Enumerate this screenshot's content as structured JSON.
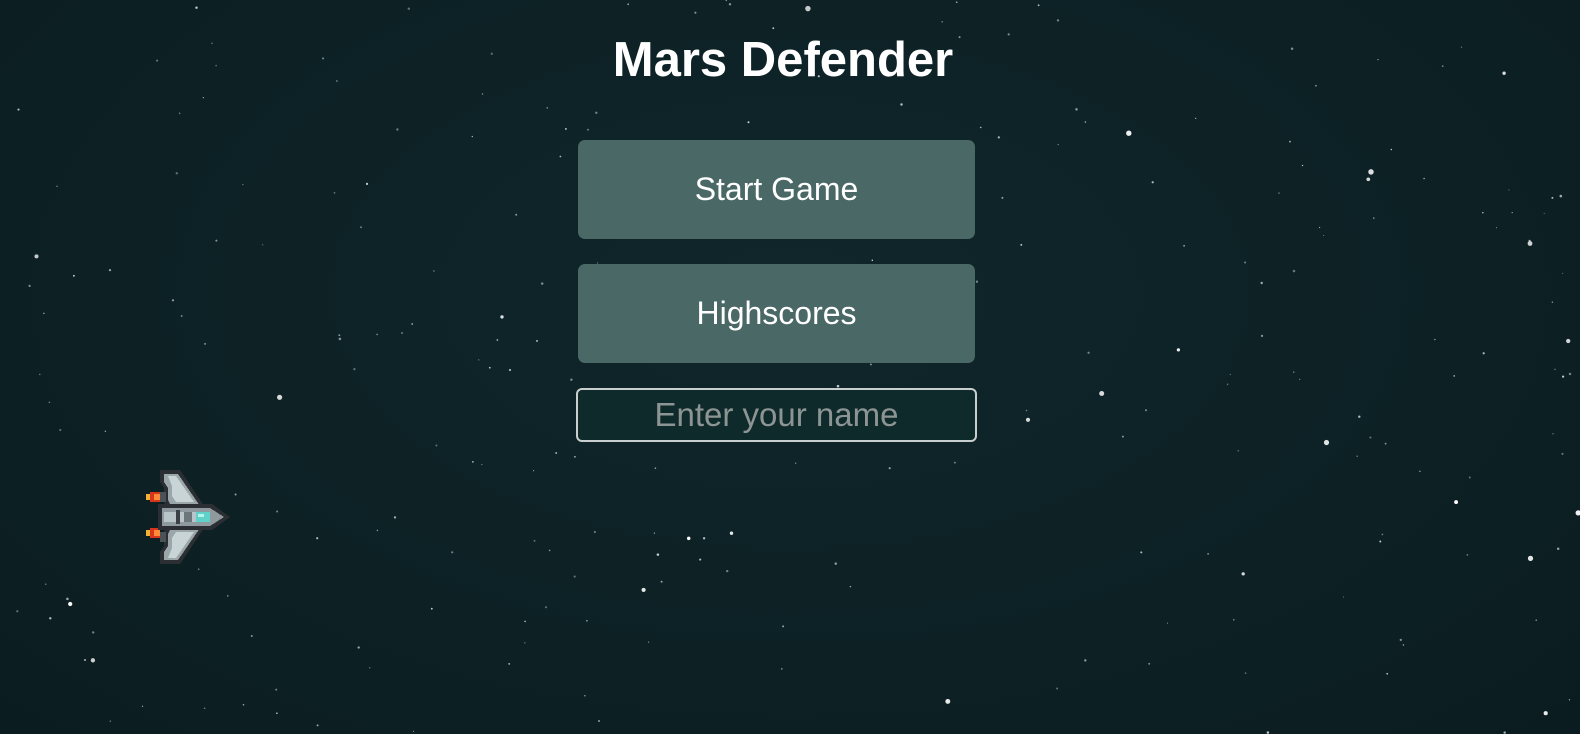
{
  "game": {
    "title": "Mars Defender"
  },
  "menu": {
    "start_label": "Start Game",
    "highscores_label": "Highscores"
  },
  "name_input": {
    "placeholder": "Enter your name",
    "value": ""
  },
  "player": {
    "sprite": "spaceship-icon"
  },
  "colors": {
    "background": "#0d2125",
    "button": "#4a6866",
    "button_text": "#ffffff",
    "input_border": "#c8cfce"
  }
}
